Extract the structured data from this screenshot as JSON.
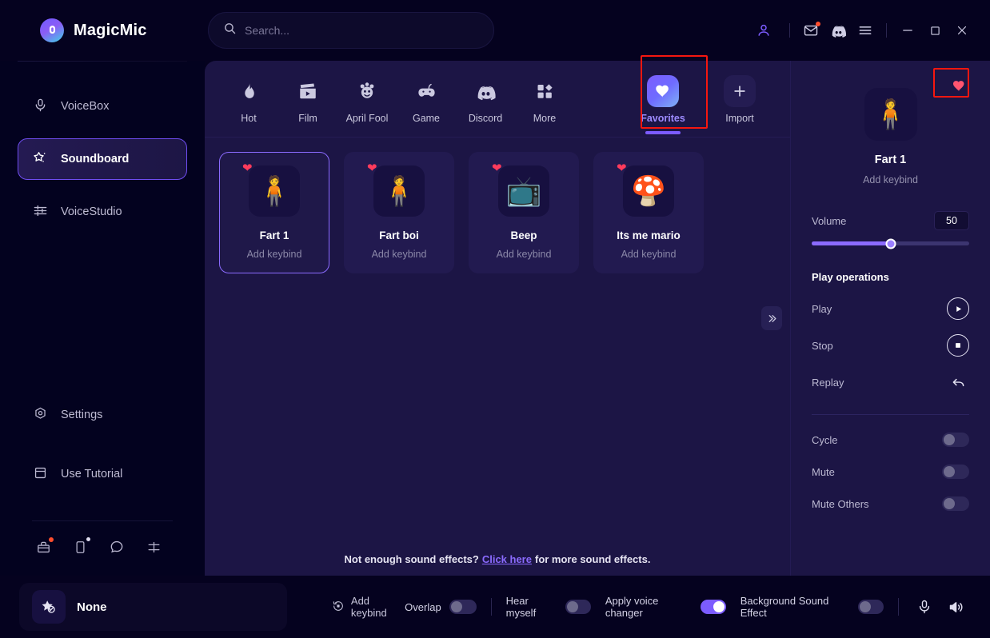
{
  "app": {
    "name": "MagicMic",
    "logo_icon": "magicmic-logo"
  },
  "search": {
    "value": "",
    "placeholder": "Search...",
    "icon": "search-icon"
  },
  "titlebar": {
    "account_icon": "account-icon",
    "mail_icon": "mail-icon",
    "discord_icon": "discord-icon",
    "menu_icon": "hamburger-menu-icon",
    "minimize_icon": "minimize-icon",
    "maximize_icon": "maximize-icon",
    "close_icon": "close-icon"
  },
  "sidebar": {
    "items": [
      {
        "label": "VoiceBox",
        "icon": "microphone-icon",
        "active": false
      },
      {
        "label": "Soundboard",
        "icon": "sparkle-star-icon",
        "active": true
      },
      {
        "label": "VoiceStudio",
        "icon": "sliders-icon",
        "active": false
      }
    ],
    "lower_items": [
      {
        "label": "Settings",
        "icon": "gear-icon"
      },
      {
        "label": "Use Tutorial",
        "icon": "book-icon"
      }
    ],
    "mini_icons": [
      "gift-box-icon",
      "mobile-device-icon",
      "chat-bubble-icon",
      "feedback-icon"
    ]
  },
  "tabs": [
    {
      "label": "Hot",
      "icon": "flame-icon",
      "active": false
    },
    {
      "label": "Film",
      "icon": "clapperboard-icon",
      "active": false
    },
    {
      "label": "April Fool",
      "icon": "clown-icon",
      "active": false
    },
    {
      "label": "Game",
      "icon": "gamepad-icon",
      "active": false
    },
    {
      "label": "Discord",
      "icon": "discord-icon",
      "active": false
    },
    {
      "label": "More",
      "icon": "grid-icon",
      "active": false
    },
    {
      "label": "Favorites",
      "icon": "heart-icon",
      "active": true
    },
    {
      "label": "Import",
      "icon": "plus-icon",
      "active": false
    }
  ],
  "cards": [
    {
      "title": "Fart 1",
      "subtitle": "Add keybind",
      "emoji": "🧍",
      "favorited": true,
      "selected": true
    },
    {
      "title": "Fart boi",
      "subtitle": "Add keybind",
      "emoji": "🧍",
      "favorited": true,
      "selected": false
    },
    {
      "title": "Beep",
      "subtitle": "Add keybind",
      "emoji": "📺",
      "favorited": true,
      "selected": false
    },
    {
      "title": "Its me mario",
      "subtitle": "Add keybind",
      "emoji": "🍄",
      "favorited": true,
      "selected": false
    }
  ],
  "collapse": {
    "icon": "double-chevron-right-icon"
  },
  "footer": {
    "prefix": "Not enough sound effects?",
    "link": "Click here",
    "suffix": "for more sound effects."
  },
  "detail": {
    "favorite_icon": "heart-filled-icon",
    "emoji": "🧍",
    "title": "Fart 1",
    "keybind": "Add keybind",
    "volume_label": "Volume",
    "volume_value": "50",
    "volume_percent": 50,
    "operations_title": "Play operations",
    "operations": [
      {
        "label": "Play",
        "icon": "play-icon"
      },
      {
        "label": "Stop",
        "icon": "stop-icon"
      },
      {
        "label": "Replay",
        "icon": "replay-icon"
      }
    ],
    "toggles": [
      {
        "label": "Cycle",
        "on": false
      },
      {
        "label": "Mute",
        "on": false
      },
      {
        "label": "Mute Others",
        "on": false
      }
    ]
  },
  "bottom": {
    "current_effect": "None",
    "current_effect_icon": "star-disabled-icon",
    "add_keybind": "Add keybind",
    "add_keybind_icon": "keybind-record-icon",
    "toggles": [
      {
        "label": "Overlap",
        "on": false
      },
      {
        "label": "Hear myself",
        "on": false
      },
      {
        "label": "Apply voice changer",
        "on": true
      },
      {
        "label": "Background Sound Effect",
        "on": false
      }
    ],
    "mic_icon": "microphone-icon",
    "speaker_icon": "speaker-icon"
  },
  "colors": {
    "accent": "#7c5cff",
    "panel_bg": "#1c1545",
    "sidebar_bg": "#03021f",
    "highlight_box": "#f5170f",
    "heart": "#ff3b5c"
  }
}
